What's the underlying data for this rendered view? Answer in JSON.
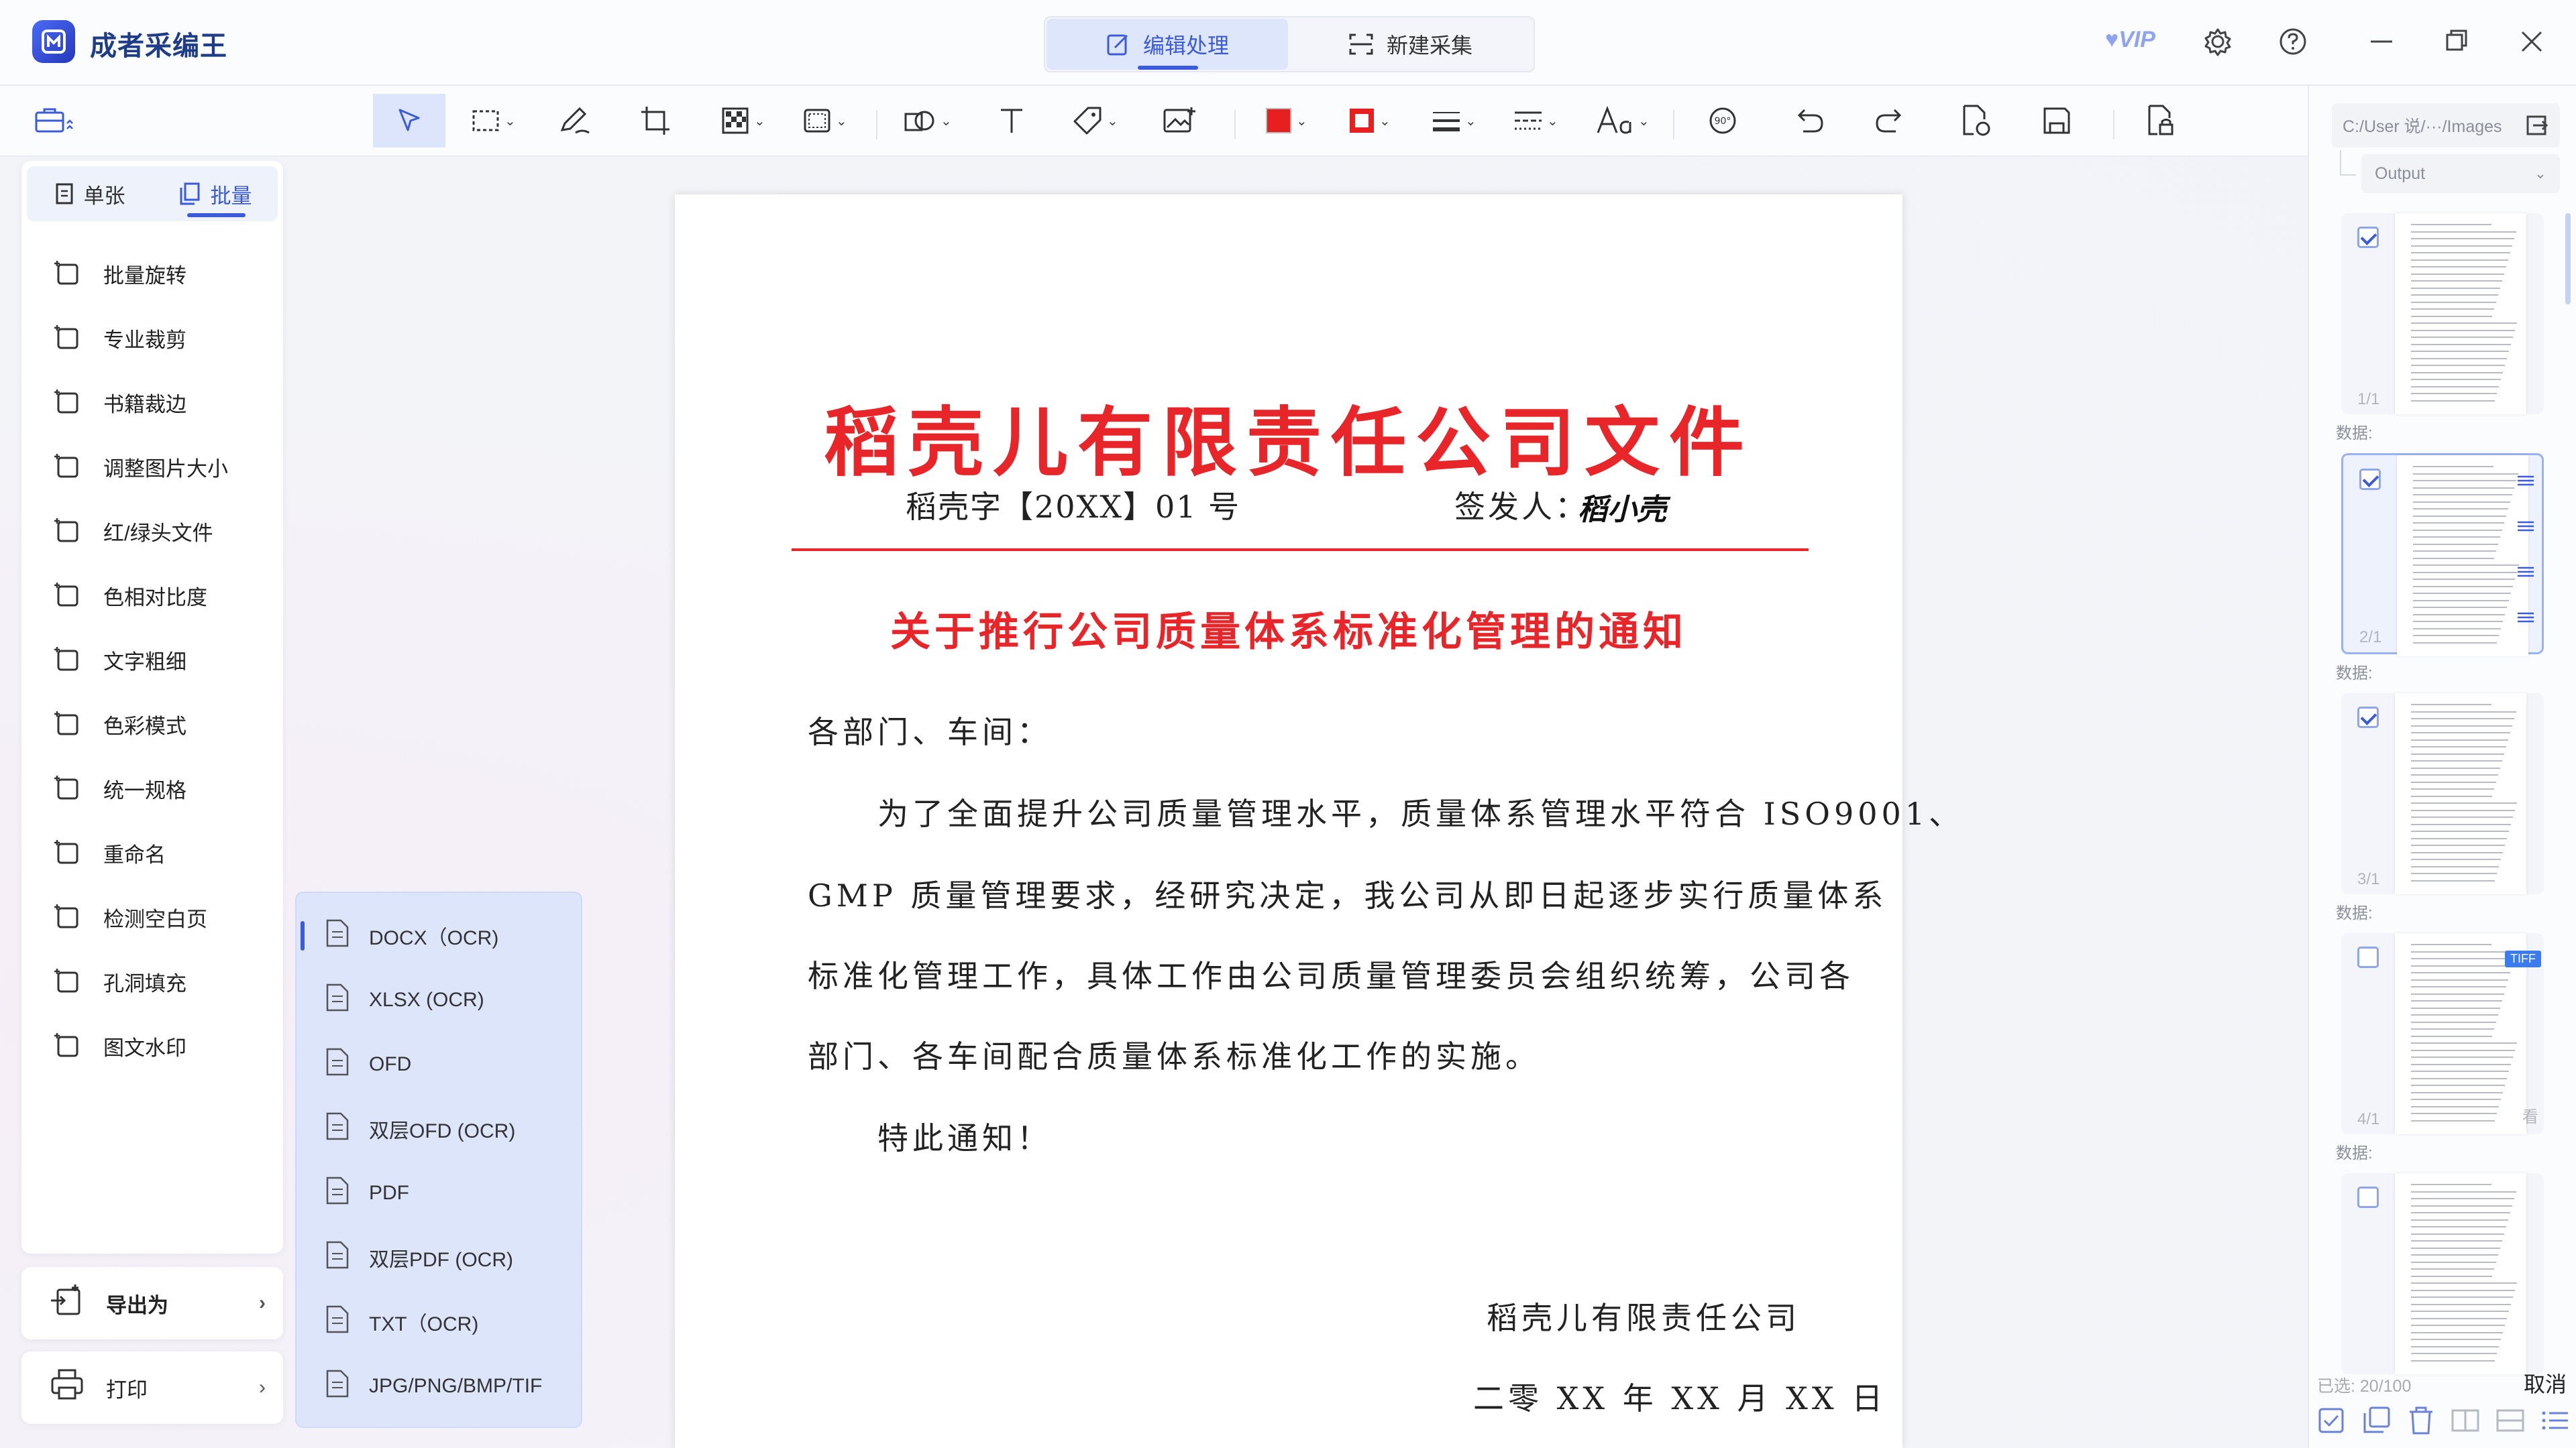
{
  "app": {
    "title": "成者采编王"
  },
  "mode_tabs": [
    {
      "label": "编辑处理"
    },
    {
      "label": "新建采集"
    }
  ],
  "vip_label": "VIP",
  "left_tabs": [
    {
      "label": "单张"
    },
    {
      "label": "批量"
    }
  ],
  "tools": [
    {
      "label": "批量旋转",
      "icon": "batch-rotate-icon"
    },
    {
      "label": "专业裁剪",
      "icon": "crop-icon"
    },
    {
      "label": "书籍裁边",
      "icon": "book-trim-icon"
    },
    {
      "label": "调整图片大小",
      "icon": "resize-icon"
    },
    {
      "label": "红/绿头文件",
      "icon": "red-green-header-icon"
    },
    {
      "label": "色相对比度",
      "icon": "hue-contrast-icon"
    },
    {
      "label": "文字粗细",
      "icon": "text-weight-icon"
    },
    {
      "label": "色彩模式",
      "icon": "color-mode-icon"
    },
    {
      "label": "统一规格",
      "icon": "unify-size-icon"
    },
    {
      "label": "重命名",
      "icon": "rename-icon"
    },
    {
      "label": "检测空白页",
      "icon": "blank-page-icon"
    },
    {
      "label": "孔洞填充",
      "icon": "hole-fill-icon"
    },
    {
      "label": "图文水印",
      "icon": "watermark-icon"
    }
  ],
  "export": {
    "label": "导出为",
    "arrow": "›"
  },
  "print": {
    "label": "打印",
    "arrow": "›"
  },
  "export_formats": [
    {
      "label": "DOCX（OCR)",
      "icon": "word-file-icon"
    },
    {
      "label": "XLSX (OCR)",
      "icon": "excel-file-icon"
    },
    {
      "label": "OFD",
      "icon": "ofd-file-icon"
    },
    {
      "label": "双层OFD (OCR)",
      "icon": "dual-ofd-file-icon"
    },
    {
      "label": "PDF",
      "icon": "pdf-file-icon"
    },
    {
      "label": "双层PDF (OCR)",
      "icon": "dual-pdf-file-icon"
    },
    {
      "label": "TXT（OCR)",
      "icon": "txt-file-icon"
    },
    {
      "label": "JPG/PNG/BMP/TIF",
      "icon": "image-file-icon"
    }
  ],
  "document": {
    "title": "稻壳儿有限责任公司文件",
    "number": "稻壳字【20XX】01 号",
    "signer_label": "签发人：",
    "signer": "稻小壳",
    "subject": "关于推行公司质量体系标准化管理的通知",
    "lines": [
      "各部门、车间：",
      "　　为了全面提升公司质量管理水平，质量体系管理水平符合 ISO9001、",
      "GMP 质量管理要求，经研究决定，我公司从即日起逐步实行质量体系",
      "标准化管理工作，具体工作由公司质量管理委员会组织统筹，公司各",
      "部门、各车间配合质量体系标准化工作的实施。",
      "　　特此通知！"
    ],
    "sign_company": "稻壳儿有限责任公司",
    "sign_date": "二零 XX 年 XX 月 XX 日"
  },
  "right_panel": {
    "path": "C:/User 说/···/Images",
    "output": "Output",
    "thumbnails": [
      {
        "page": "1/1",
        "data_label": "数据:",
        "checked": true,
        "selected": false
      },
      {
        "page": "2/1",
        "data_label": "数据:",
        "checked": true,
        "selected": true
      },
      {
        "page": "3/1",
        "data_label": "数据:",
        "checked": true,
        "selected": false
      },
      {
        "page": "4/1",
        "data_label": "数据:",
        "checked": false,
        "selected": false,
        "badge": "TIFF",
        "side_text": "看"
      },
      {
        "page": "",
        "data_label": "",
        "checked": false,
        "selected": false
      }
    ],
    "selected_count": "已选: 20/100",
    "cancel": "取消"
  },
  "colors": {
    "accent": "#3b5bdb",
    "doc_red": "#e8262a",
    "panel_bg": "#fbfcfe"
  }
}
